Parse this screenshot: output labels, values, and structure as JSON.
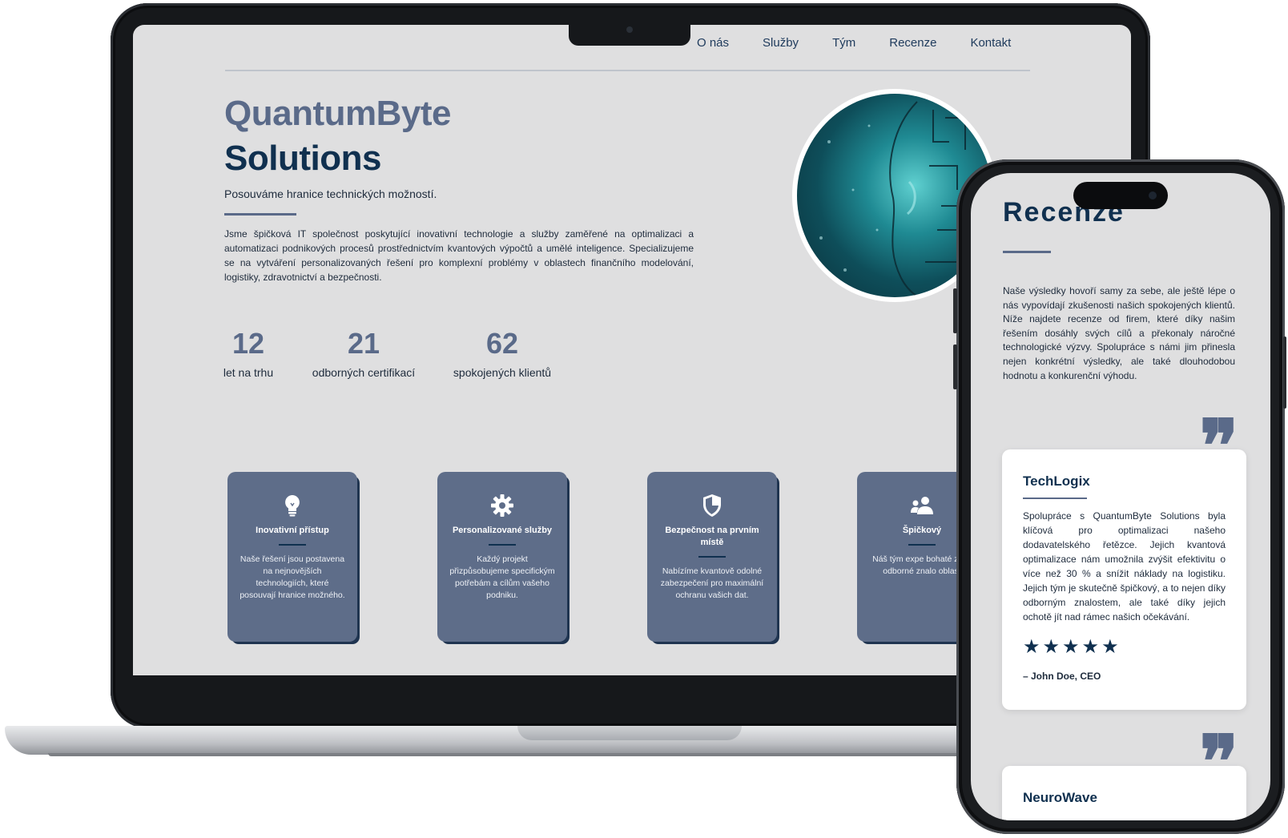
{
  "desktop": {
    "nav": [
      "O nás",
      "Služby",
      "Tým",
      "Recenze",
      "Kontakt"
    ],
    "hero": {
      "title_line1": "QuantumByte",
      "title_line2": "Solutions",
      "tagline": "Posouváme hranice technických možností.",
      "description": "Jsme špičková IT společnost poskytující inovativní technologie a služby zaměřené na optimalizaci a automatizaci podnikových procesů prostřednictvím kvantových výpočtů a umělé inteligence. Specializujeme se na vytváření personalizovaných řešení pro komplexní problémy v oblastech finančního modelování, logistiky, zdravotnictví a bezpečnosti."
    },
    "stats": [
      {
        "number": "12",
        "label": "let na trhu"
      },
      {
        "number": "21",
        "label": "odborných certifikací"
      },
      {
        "number": "62",
        "label": "spokojených klientů"
      }
    ],
    "cards": [
      {
        "icon": "lightbulb-icon",
        "title": "Inovativní přístup",
        "text": "Naše řešení jsou postavena na nejnovějších technologiích, které posouvají hranice možného."
      },
      {
        "icon": "gear-icon",
        "title": "Personalizované služby",
        "text": "Každý projekt přizpůsobujeme specifickým potřebám a cílům vašeho podniku."
      },
      {
        "icon": "shield-icon",
        "title": "Bezpečnost na prvním místě",
        "text": "Nabízíme kvantově odolné zabezpečení pro maximální ochranu vašich dat."
      },
      {
        "icon": "team-icon",
        "title": "Špičkový",
        "text": "Náš tým expe bohaté zkuš odborné znalo oblast"
      }
    ]
  },
  "mobile": {
    "section_title": "Recenze",
    "description": "Naše výsledky hovoří samy za sebe, ale ještě lépe o nás vypovídají zkušenosti našich spokojených klientů. Níže najdete recenze od firem, které díky našim řešením dosáhly svých cílů a překonaly náročné technologické výzvy. Spolupráce s námi jim přinesla nejen konkrétní výsledky, ale také dlouhodobou hodnotu a konkurenční výhodu.",
    "reviews": [
      {
        "company": "TechLogix",
        "text": "Spolupráce s QuantumByte Solutions byla klíčová pro optimalizaci našeho dodavatelského řetězce. Jejich kvantová optimalizace nám umožnila zvýšit efektivitu o více než 30 % a snížit náklady na logistiku. Jejich tým je skutečně špičkový, a to nejen díky odborným znalostem, ale také díky jejich ochotě jít nad rámec našich očekávání.",
        "stars": "★★★★★",
        "rating": 5,
        "author": "– John Doe, CEO"
      },
      {
        "company": "NeuroWave"
      }
    ],
    "quote_glyph": "❞"
  }
}
